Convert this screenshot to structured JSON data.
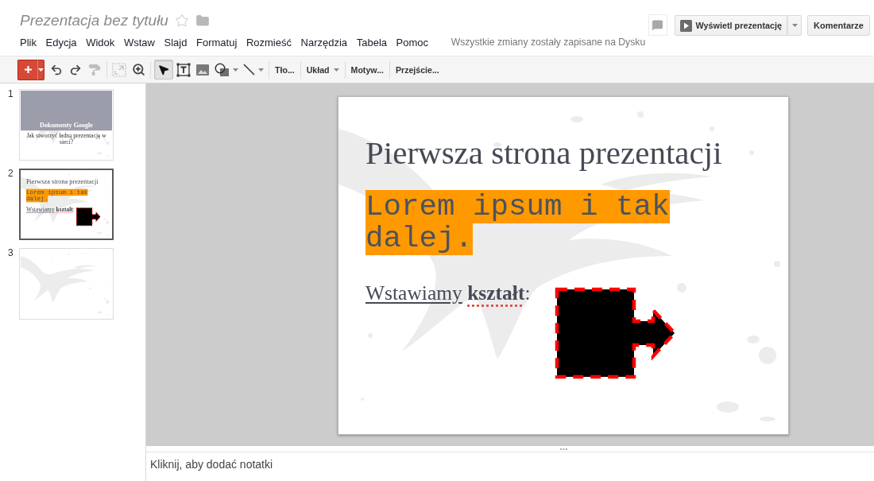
{
  "document": {
    "title": "Prezentacja bez tytułu",
    "starred": false
  },
  "menu": [
    "Plik",
    "Edycja",
    "Widok",
    "Wstaw",
    "Slajd",
    "Formatuj",
    "Rozmieść",
    "Narzędzia",
    "Tabela",
    "Pomoc"
  ],
  "save_status": "Wszystkie zmiany zostały zapisane na Dysku",
  "header_buttons": {
    "present": "Wyświetl prezentację",
    "comments": "Komentarze"
  },
  "toolbar": {
    "edit_tools": [
      {
        "kind": "undo",
        "disabled": false
      },
      {
        "kind": "redo",
        "disabled": false
      },
      {
        "kind": "paint",
        "disabled": true
      }
    ],
    "view_tools": [
      {
        "kind": "fit",
        "disabled": true
      },
      {
        "kind": "zoom",
        "disabled": false
      }
    ],
    "insert_tools": [
      {
        "kind": "pointer",
        "selected": true,
        "has_menu": false
      },
      {
        "kind": "textbox",
        "selected": false,
        "has_menu": false
      },
      {
        "kind": "image",
        "selected": false,
        "has_menu": false
      },
      {
        "kind": "shape",
        "selected": false,
        "has_menu": true
      },
      {
        "kind": "line",
        "selected": false,
        "has_menu": true
      }
    ],
    "menus": [
      {
        "label": "Tło...",
        "has_menu": false
      },
      {
        "label": "Układ",
        "has_menu": true
      },
      {
        "label": "Motyw...",
        "has_menu": false
      },
      {
        "label": "Przejście...",
        "has_menu": false
      }
    ]
  },
  "slides": [
    {
      "number": "1",
      "selected": false,
      "kind": "title",
      "title": "Dokumenty Google",
      "subtitle": "Jak stworzyć ładną prezentację w sieci?"
    },
    {
      "number": "2",
      "selected": true,
      "kind": "content",
      "title": "Pierwsza strona prezentacji",
      "highlight": "Lorem ipsum i tak dalej.",
      "body": {
        "underlined_text": "Wstawiamy",
        "bold_text": "kształt",
        "bold_text_misspelled": true,
        "end_text": ":"
      }
    },
    {
      "number": "3",
      "selected": false,
      "kind": "blank"
    }
  ],
  "editor_slide": {
    "kind": "content",
    "title": "Pierwsza strona prezentacji",
    "highlight": "Lorem ipsum i tak dalej.",
    "body": {
      "underlined_text": "Wstawiamy",
      "bold_text": "kształt",
      "bold_text_misspelled": true,
      "end_text": ":"
    }
  },
  "notes": {
    "placeholder": "Kliknij, aby dodać notatki"
  }
}
